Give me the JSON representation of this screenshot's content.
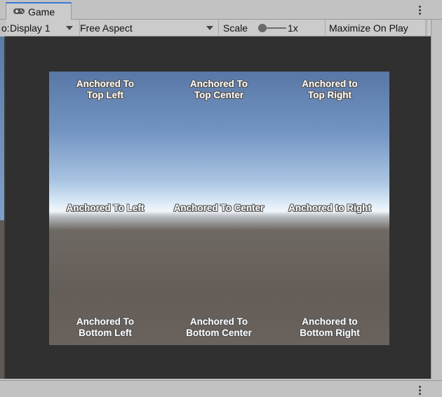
{
  "tab": {
    "title": "Game",
    "icon": "gamepad-icon"
  },
  "toolbar": {
    "cut_left_text": "o:",
    "display": "Display 1",
    "aspect": "Free Aspect",
    "scale_label": "Scale",
    "scale_value": "1x",
    "maximize": "Maximize On Play"
  },
  "viewport": {
    "labels": {
      "top_left": [
        "Anchored To",
        "Top Left"
      ],
      "top_center": [
        "Anchored To",
        "Top Center"
      ],
      "top_right": [
        "Anchored to",
        "Top Right"
      ],
      "left": [
        "Anchored To Left"
      ],
      "center": [
        "Anchored To Center"
      ],
      "right": [
        "Anchored to Right"
      ],
      "bottom_left": [
        "Anchored To",
        "Bottom Left"
      ],
      "bottom_center": [
        "Anchored To",
        "Bottom Center"
      ],
      "bottom_right": [
        "Anchored to",
        "Bottom Right"
      ]
    }
  },
  "colors": {
    "tab_accent": "#3a79d8",
    "game_background": "#303030"
  }
}
